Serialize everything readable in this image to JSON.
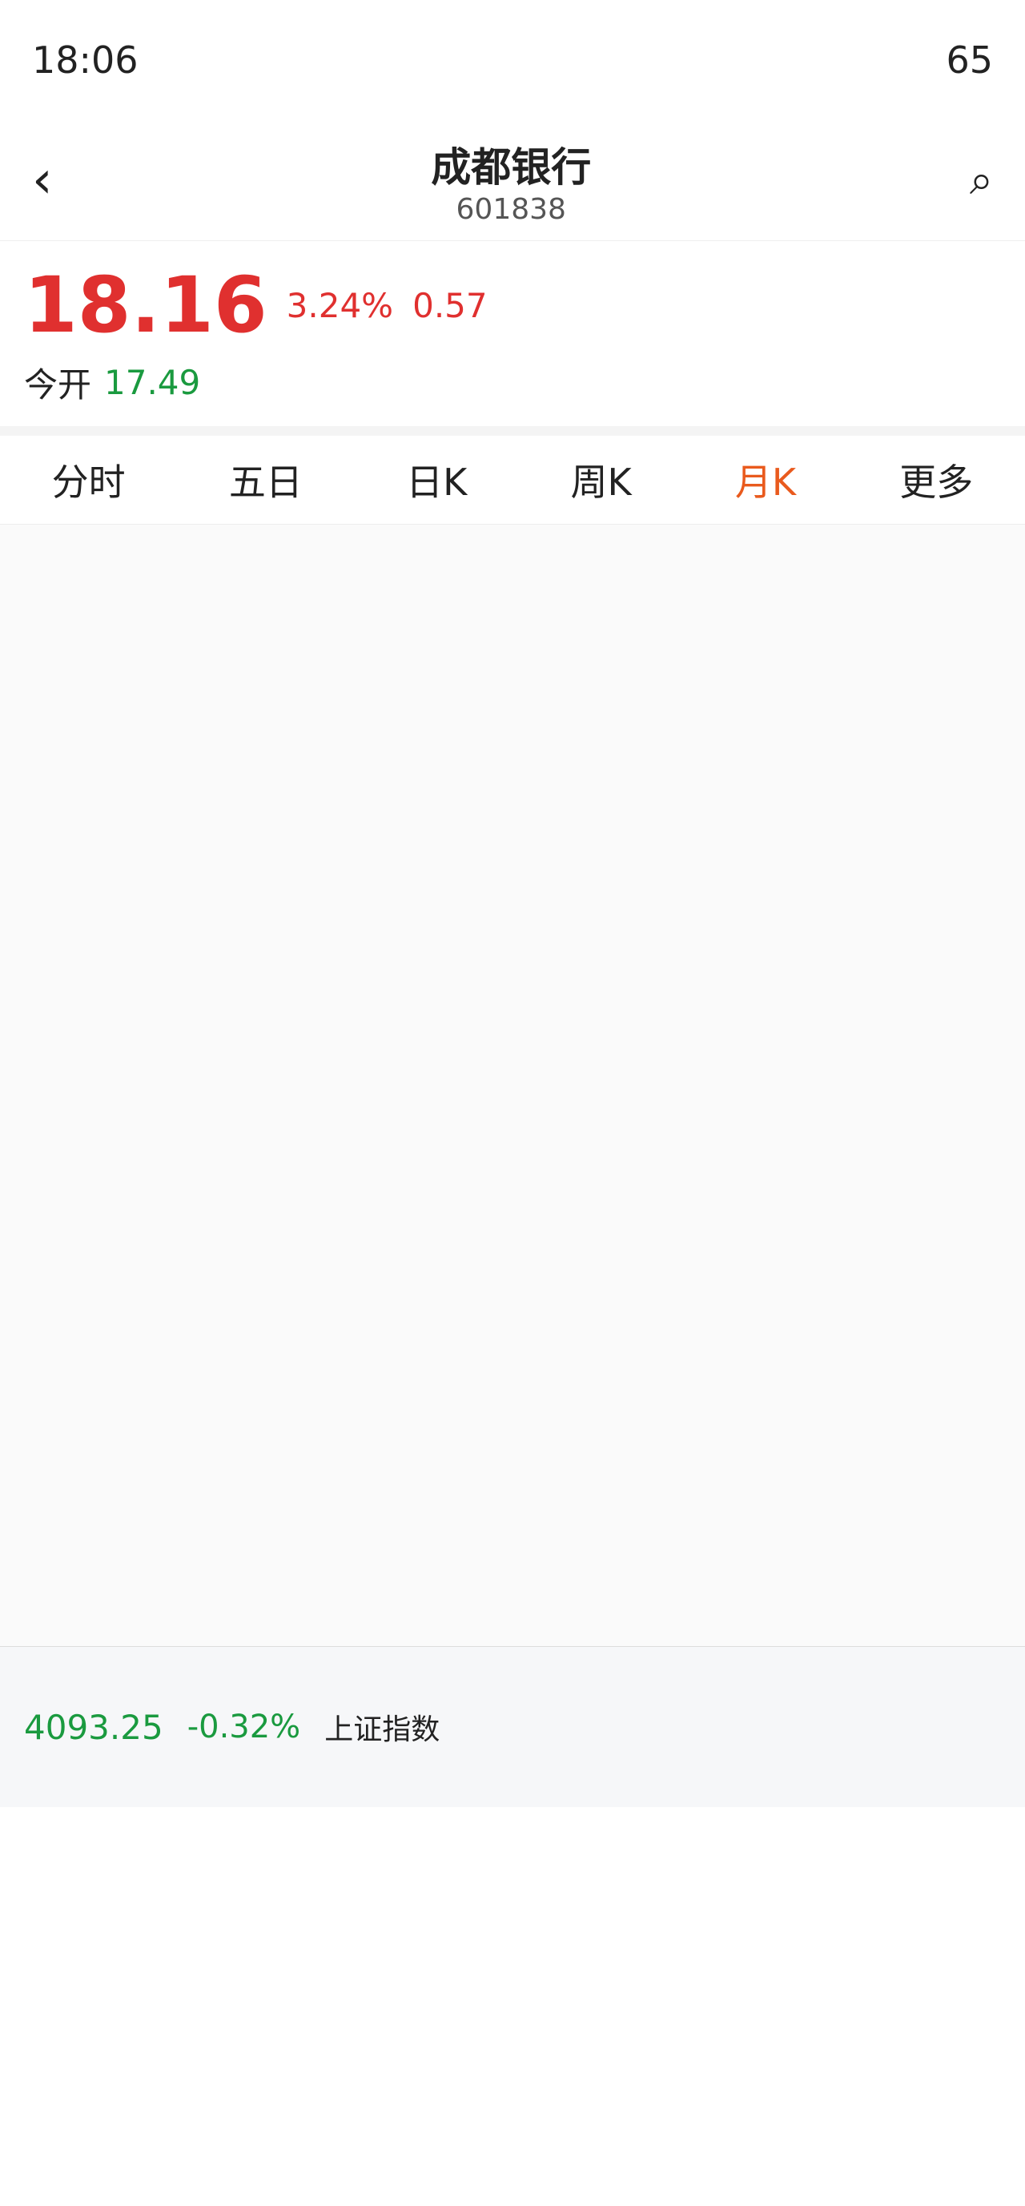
{
  "status": {
    "time": "18:06",
    "battery": "65"
  },
  "header": {
    "title": "成都银行",
    "code": "601838"
  },
  "quote": {
    "price": "18.16",
    "pct": "3.24%",
    "chg": "0.57",
    "open_label": "今开",
    "open": "17.49"
  },
  "tabs": [
    "分时",
    "五日",
    "日K",
    "周K",
    "月K",
    "更多"
  ],
  "bottom": {
    "index": "4093.25",
    "index_pct": "-0.32%",
    "name": "上证指数"
  }
}
